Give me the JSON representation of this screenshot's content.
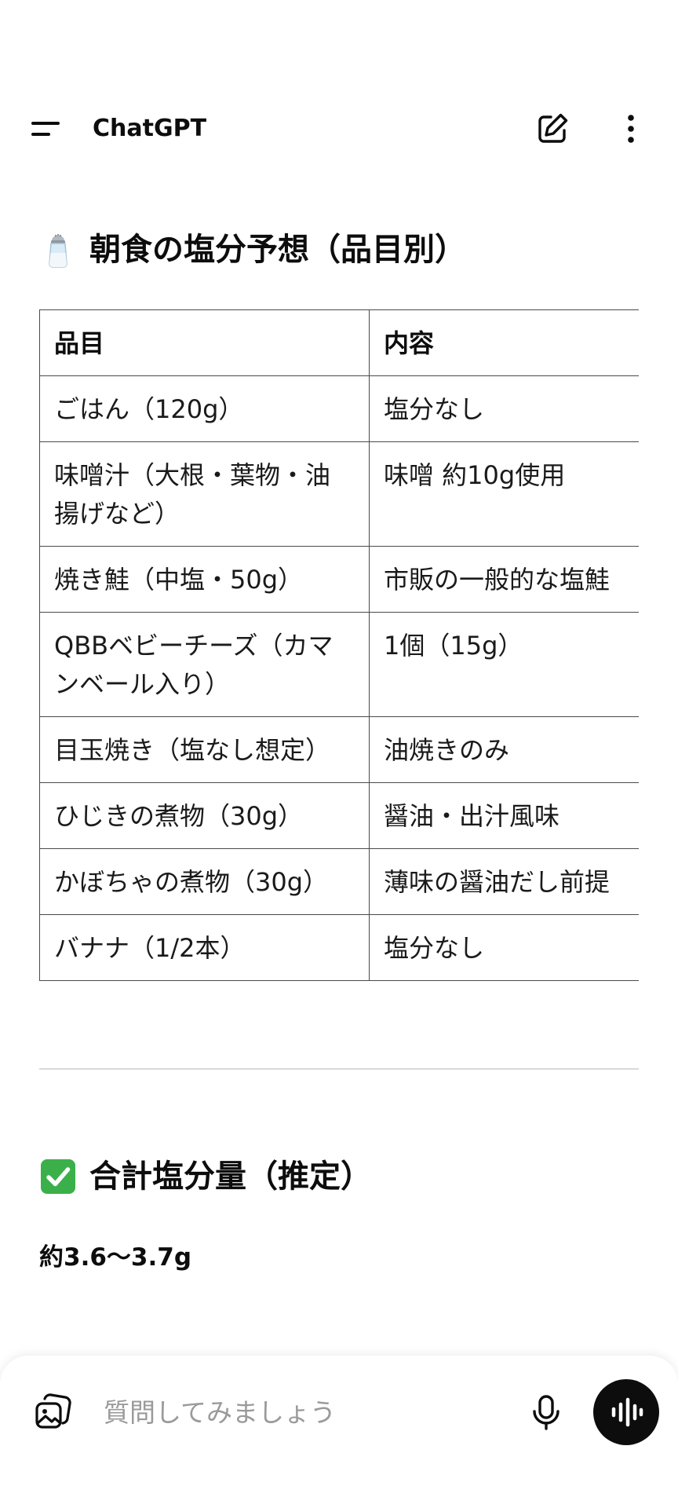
{
  "header": {
    "title": "ChatGPT",
    "menu_icon": "menu-icon",
    "new_chat_icon": "new-chat-icon",
    "more_icon": "more-vertical-icon"
  },
  "content": {
    "heading1": {
      "icon": "salt-shaker-icon",
      "text": "朝食の塩分予想（品目別）"
    },
    "table": {
      "headers": [
        "品目",
        "内容"
      ],
      "rows": [
        [
          "ごはん（120g）",
          "塩分なし"
        ],
        [
          "味噌汁（大根・葉物・油揚げなど）",
          "味噌 約10g使用"
        ],
        [
          "焼き鮭（中塩・50g）",
          "市販の一般的な塩鮭"
        ],
        [
          "QBBベビーチーズ（カマンベール入り）",
          "1個（15g）"
        ],
        [
          "目玉焼き（塩なし想定）",
          "油焼きのみ"
        ],
        [
          "ひじきの煮物（30g）",
          "醤油・出汁風味"
        ],
        [
          "かぼちゃの煮物（30g）",
          "薄味の醤油だし前提"
        ],
        [
          "バナナ（1/2本）",
          "塩分なし"
        ]
      ]
    },
    "heading2": {
      "icon": "check-mark-button-icon",
      "text": "合計塩分量（推定）"
    },
    "total_value": "約3.6〜3.7g"
  },
  "composer": {
    "placeholder": "質問してみましょう",
    "value": "",
    "attach_icon": "image-attach-icon",
    "mic_icon": "microphone-icon",
    "voice_icon": "voice-mode-icon"
  },
  "colors": {
    "text": "#0d0d0d",
    "border": "#4a4a4a",
    "check_green": "#3bb04a",
    "placeholder": "#9a9a9a"
  }
}
